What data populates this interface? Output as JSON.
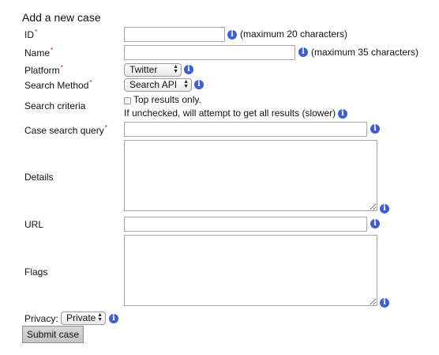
{
  "form": {
    "title": "Add a new case",
    "required_mark": "*",
    "info_glyph": "i",
    "id": {
      "label": "ID",
      "value": "",
      "hint": "(maximum 20 characters)"
    },
    "name": {
      "label": "Name",
      "value": "",
      "hint": "(maximum 35 characters)"
    },
    "platform": {
      "label": "Platform",
      "selected": "Twitter"
    },
    "search_method": {
      "label": "Search Method",
      "selected": "Search API"
    },
    "search_criteria": {
      "label": "Search criteria",
      "checkbox_label": "Top results only.",
      "checked": false,
      "note": "If unchecked, will attempt to get all results (slower)"
    },
    "case_search_query": {
      "label": "Case search query",
      "value": ""
    },
    "details": {
      "label": "Details",
      "value": ""
    },
    "url": {
      "label": "URL",
      "value": ""
    },
    "flags": {
      "label": "Flags",
      "value": ""
    },
    "privacy": {
      "label": "Privacy:",
      "selected": "Private"
    },
    "submit_label": "Submit case"
  },
  "colors": {
    "info_icon": "#3d5ed8",
    "required_mark": "#d0021b"
  },
  "icons": {
    "info": "info-icon",
    "select_arrows": "up-down-arrows-icon",
    "resize": "resize-grip-icon"
  }
}
